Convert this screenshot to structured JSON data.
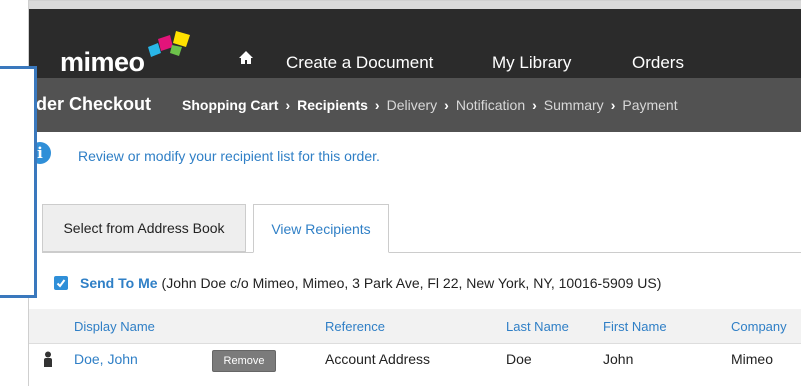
{
  "colors": {
    "accent": "#2f7fc6",
    "nav_bg": "#2b2b2b",
    "crumb_bg": "#525252",
    "callout": "#3a78bd"
  },
  "topnav": {
    "logo_text": "mimeo",
    "home_icon": "home-icon",
    "items": [
      "Create a Document",
      "My Library",
      "Orders"
    ]
  },
  "breadcrumb": {
    "title": "rder Checkout",
    "steps": [
      "Shopping Cart",
      "Recipients",
      "Delivery",
      "Notification",
      "Summary",
      "Payment"
    ],
    "separator": "›"
  },
  "info": {
    "icon": "info-icon",
    "icon_glyph": "i",
    "text": "Review or modify your recipient list for this order."
  },
  "tabs": [
    "Select from Address Book",
    "View Recipients"
  ],
  "send_to_me": {
    "label": "Send To Me",
    "detail": "(John Doe c/o Mimeo, Mimeo, 3 Park Ave, Fl 22, New York, NY, 10016-5909 US)"
  },
  "table": {
    "columns": [
      "Display Name",
      "Reference",
      "Last Name",
      "First Name",
      "Company"
    ],
    "rows": [
      {
        "display_name": "Doe, John",
        "remove_label": "Remove",
        "reference": "Account Address",
        "last_name": "Doe",
        "first_name": "John",
        "company": "Mimeo"
      }
    ]
  }
}
